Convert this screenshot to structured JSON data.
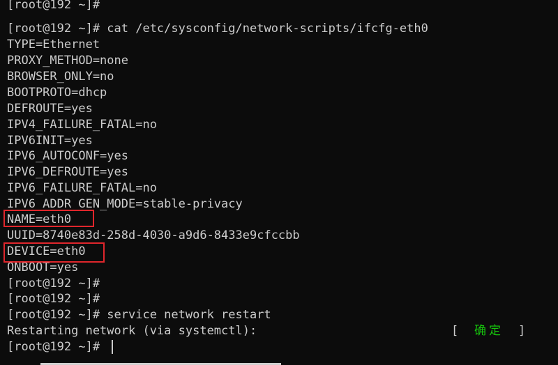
{
  "terminal": {
    "lines": [
      "[root@192 ~]#",
      "[root@192 ~]# cat /etc/sysconfig/network-scripts/ifcfg-eth0",
      "TYPE=Ethernet",
      "PROXY_METHOD=none",
      "BROWSER_ONLY=no",
      "BOOTPROTO=dhcp",
      "DEFROUTE=yes",
      "IPV4_FAILURE_FATAL=no",
      "IPV6INIT=yes",
      "IPV6_AUTOCONF=yes",
      "IPV6_DEFROUTE=yes",
      "IPV6_FAILURE_FATAL=no",
      "IPV6_ADDR_GEN_MODE=stable-privacy",
      "NAME=eth0",
      "UUID=8740e83d-258d-4030-a9d6-8433e9cfccbb",
      "DEVICE=eth0",
      "ONBOOT=yes",
      "[root@192 ~]#",
      "[root@192 ~]#",
      "[root@192 ~]# service network restart",
      "Restarting network (via systemctl):",
      "[root@192 ~]#"
    ],
    "status": {
      "open_bracket": "[",
      "ok_text": "确定",
      "close_bracket": "]"
    },
    "colors": {
      "background": "#0c0c0c",
      "text": "#cccccc",
      "ok_green": "#16c60c",
      "highlight_red": "#e0262c"
    }
  }
}
